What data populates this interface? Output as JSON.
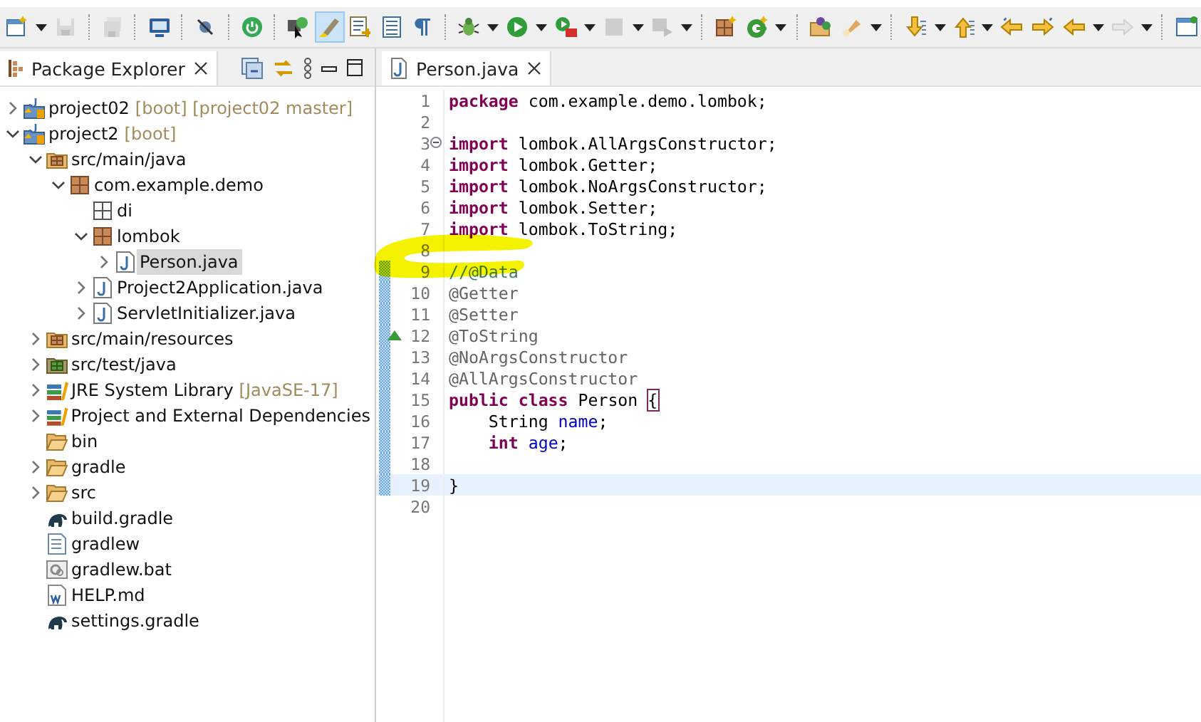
{
  "toolbar": {
    "buttons": [
      {
        "selected": false,
        "disabled": false
      },
      {
        "selected": false,
        "disabled": true
      },
      {
        "selected": false,
        "disabled": true
      },
      {
        "selected": false,
        "disabled": false
      },
      {
        "selected": false,
        "disabled": false
      },
      {
        "selected": false,
        "disabled": false
      },
      {
        "selected": false,
        "disabled": false
      },
      {
        "selected": true,
        "disabled": false
      },
      {
        "selected": false,
        "disabled": false
      },
      {
        "selected": false,
        "disabled": false
      },
      {
        "selected": false,
        "disabled": false
      },
      {
        "selected": false,
        "disabled": false
      },
      {
        "selected": false,
        "disabled": false
      },
      {
        "selected": false,
        "disabled": false
      },
      {
        "selected": false,
        "disabled": true
      },
      {
        "selected": false,
        "disabled": true
      },
      {
        "selected": false,
        "disabled": false
      },
      {
        "selected": false,
        "disabled": false
      },
      {
        "selected": false,
        "disabled": false
      },
      {
        "selected": false,
        "disabled": false
      },
      {
        "selected": false,
        "disabled": false
      },
      {
        "selected": false,
        "disabled": false
      },
      {
        "selected": false,
        "disabled": false
      },
      {
        "selected": false,
        "disabled": false
      },
      {
        "selected": false,
        "disabled": false
      },
      {
        "selected": false,
        "disabled": true
      },
      {
        "selected": false,
        "disabled": false
      }
    ]
  },
  "explorer": {
    "tab": {
      "label": "Package Explorer",
      "selected": true
    },
    "tree": [
      {
        "kind": "project",
        "label": "project02",
        "decoration": "[boot] [project02 master]",
        "expanded": false,
        "selected": false
      },
      {
        "kind": "project",
        "label": "project2",
        "decoration": "[boot]",
        "expanded": true,
        "selected": false,
        "children": [
          {
            "kind": "source-folder",
            "label": "src/main/java",
            "expanded": true,
            "selected": false,
            "children": [
              {
                "kind": "package",
                "label": "com.example.demo",
                "expanded": true,
                "selected": false,
                "children": [
                  {
                    "kind": "empty-package",
                    "label": "di",
                    "selected": false
                  },
                  {
                    "kind": "package",
                    "label": "lombok",
                    "expanded": true,
                    "selected": false,
                    "children": [
                      {
                        "kind": "java",
                        "label": "Person.java",
                        "expanded": false,
                        "selected": true
                      }
                    ]
                  },
                  {
                    "kind": "java",
                    "label": "Project2Application.java",
                    "expanded": false,
                    "selected": false
                  },
                  {
                    "kind": "java",
                    "label": "ServletInitializer.java",
                    "expanded": false,
                    "selected": false
                  }
                ]
              }
            ]
          },
          {
            "kind": "source-folder",
            "label": "src/main/resources",
            "expanded": false,
            "selected": false
          },
          {
            "kind": "test-folder",
            "label": "src/test/java",
            "expanded": false,
            "selected": false
          },
          {
            "kind": "library",
            "label": "JRE System Library",
            "decoration": "[JavaSE-17]",
            "expanded": false,
            "selected": false
          },
          {
            "kind": "library",
            "label": "Project and External Dependencies",
            "expanded": false,
            "selected": false
          },
          {
            "kind": "folder",
            "label": "bin",
            "selected": false
          },
          {
            "kind": "folder",
            "label": "gradle",
            "expanded": false,
            "selected": false
          },
          {
            "kind": "folder",
            "label": "src",
            "expanded": false,
            "selected": false
          },
          {
            "kind": "gradle",
            "label": "build.gradle",
            "selected": false
          },
          {
            "kind": "text",
            "label": "gradlew",
            "selected": false
          },
          {
            "kind": "batch",
            "label": "gradlew.bat",
            "selected": false
          },
          {
            "kind": "doc",
            "label": "HELP.md",
            "selected": false
          },
          {
            "kind": "gradle",
            "label": "settings.gradle",
            "selected": false
          }
        ]
      }
    ]
  },
  "editor": {
    "tabs": [
      {
        "label": "Person.java",
        "selected": true
      }
    ],
    "lines": [
      {
        "number": "1",
        "tokens": [
          {
            "kind": "keyword",
            "text": "package"
          },
          {
            "kind": "plain",
            "text": " com.example.demo.lombok;"
          }
        ]
      },
      {
        "number": "2"
      },
      {
        "number": "3",
        "fold_open": true,
        "tokens": [
          {
            "kind": "keyword",
            "text": "import"
          },
          {
            "kind": "plain",
            "text": " lombok.AllArgsConstructor;"
          }
        ]
      },
      {
        "number": "4",
        "tokens": [
          {
            "kind": "keyword",
            "text": "import"
          },
          {
            "kind": "plain",
            "text": " lombok.Getter;"
          }
        ]
      },
      {
        "number": "5",
        "tokens": [
          {
            "kind": "keyword",
            "text": "import"
          },
          {
            "kind": "plain",
            "text": " lombok.NoArgsConstructor;"
          }
        ]
      },
      {
        "number": "6",
        "tokens": [
          {
            "kind": "keyword",
            "text": "import"
          },
          {
            "kind": "plain",
            "text": " lombok.Setter;"
          }
        ]
      },
      {
        "number": "7",
        "tokens": [
          {
            "kind": "keyword",
            "text": "import"
          },
          {
            "kind": "plain",
            "text": " lombok.ToString;"
          }
        ]
      },
      {
        "number": "8"
      },
      {
        "number": "9",
        "changed": true,
        "tokens": [
          {
            "kind": "comment",
            "text": "//@Data"
          }
        ]
      },
      {
        "number": "10",
        "changed": true,
        "tokens": [
          {
            "kind": "annotation",
            "text": "@Getter"
          }
        ]
      },
      {
        "number": "11",
        "changed": true,
        "tokens": [
          {
            "kind": "annotation",
            "text": "@Setter"
          }
        ]
      },
      {
        "number": "12",
        "changed": true,
        "override": true,
        "tokens": [
          {
            "kind": "annotation",
            "text": "@ToString"
          }
        ]
      },
      {
        "number": "13",
        "changed": true,
        "tokens": [
          {
            "kind": "annotation",
            "text": "@NoArgsConstructor"
          }
        ]
      },
      {
        "number": "14",
        "changed": true,
        "tokens": [
          {
            "kind": "annotation",
            "text": "@AllArgsConstructor"
          }
        ]
      },
      {
        "number": "15",
        "changed": true,
        "tokens": [
          {
            "kind": "keyword",
            "text": "public"
          },
          {
            "kind": "keyword",
            "text": " class"
          },
          {
            "kind": "plain",
            "text": " Person "
          },
          {
            "kind": "plain",
            "text": "{",
            "matched": true
          }
        ]
      },
      {
        "number": "16",
        "changed": true,
        "tokens": [
          {
            "kind": "plain",
            "text": "    String"
          },
          {
            "kind": "field",
            "text": " name"
          },
          {
            "kind": "plain",
            "text": ";"
          }
        ]
      },
      {
        "number": "17",
        "changed": true,
        "tokens": [
          {
            "kind": "keyword",
            "text": "    int"
          },
          {
            "kind": "field",
            "text": " age"
          },
          {
            "kind": "plain",
            "text": ";"
          }
        ]
      },
      {
        "number": "18",
        "changed": true
      },
      {
        "number": "19",
        "changed": true,
        "current": true,
        "tokens": [
          {
            "kind": "plain",
            "text": "}"
          }
        ]
      },
      {
        "number": "20"
      }
    ]
  }
}
